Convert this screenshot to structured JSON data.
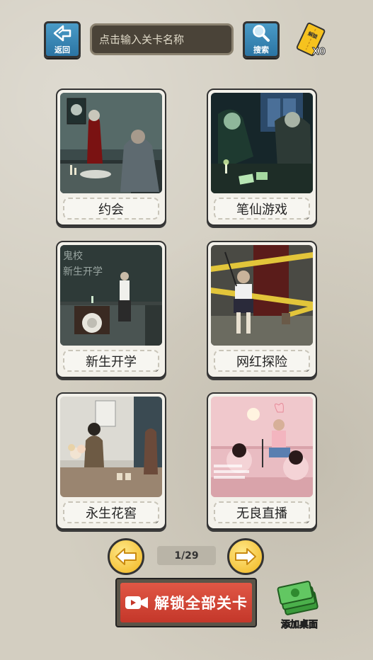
{
  "topbar": {
    "back_label": "返回",
    "search_placeholder": "点击输入关卡名称",
    "search_label": "搜索",
    "ticket_text": "解锁",
    "ticket_count": "X0"
  },
  "levels": [
    {
      "title": "约会",
      "locked": false
    },
    {
      "title": "笔仙游戏",
      "locked": true
    },
    {
      "title": "新生开学",
      "locked": true,
      "scene_text": "鬼校\n新生开学"
    },
    {
      "title": "网红探险",
      "locked": true
    },
    {
      "title": "永生花窖",
      "locked": true
    },
    {
      "title": "无良直播",
      "locked": true
    }
  ],
  "pager": {
    "indicator": "1/29"
  },
  "actions": {
    "unlock_all_label": "解锁全部关卡",
    "add_desktop_label": "添加桌面"
  },
  "colors": {
    "blue_button": "#2b74a3",
    "gold_arrow": "#f1b51c",
    "unlock_red": "#c4372a"
  }
}
